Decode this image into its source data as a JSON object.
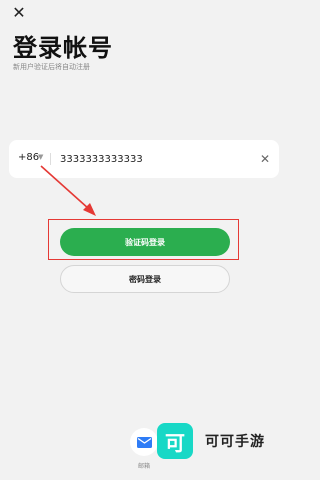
{
  "header": {
    "close_icon": "close-icon",
    "title": "登录帐号",
    "subtitle": "新用户验证后将自动注册"
  },
  "phone": {
    "country_code": "+86",
    "value": "3333333333333",
    "clear_icon": "clear-icon"
  },
  "buttons": {
    "sms_login": "验证码登录",
    "password_login": "密码登录"
  },
  "other_login": {
    "email_label": "邮箱",
    "email_icon": "mail-icon"
  },
  "watermark": {
    "logo_char": "可",
    "text": "可可手游"
  },
  "colors": {
    "background": "#f2f2f2",
    "primary": "#2bae4f",
    "annotation": "#e53935",
    "email_icon": "#2e7cf6",
    "watermark": "#18d8c6"
  }
}
